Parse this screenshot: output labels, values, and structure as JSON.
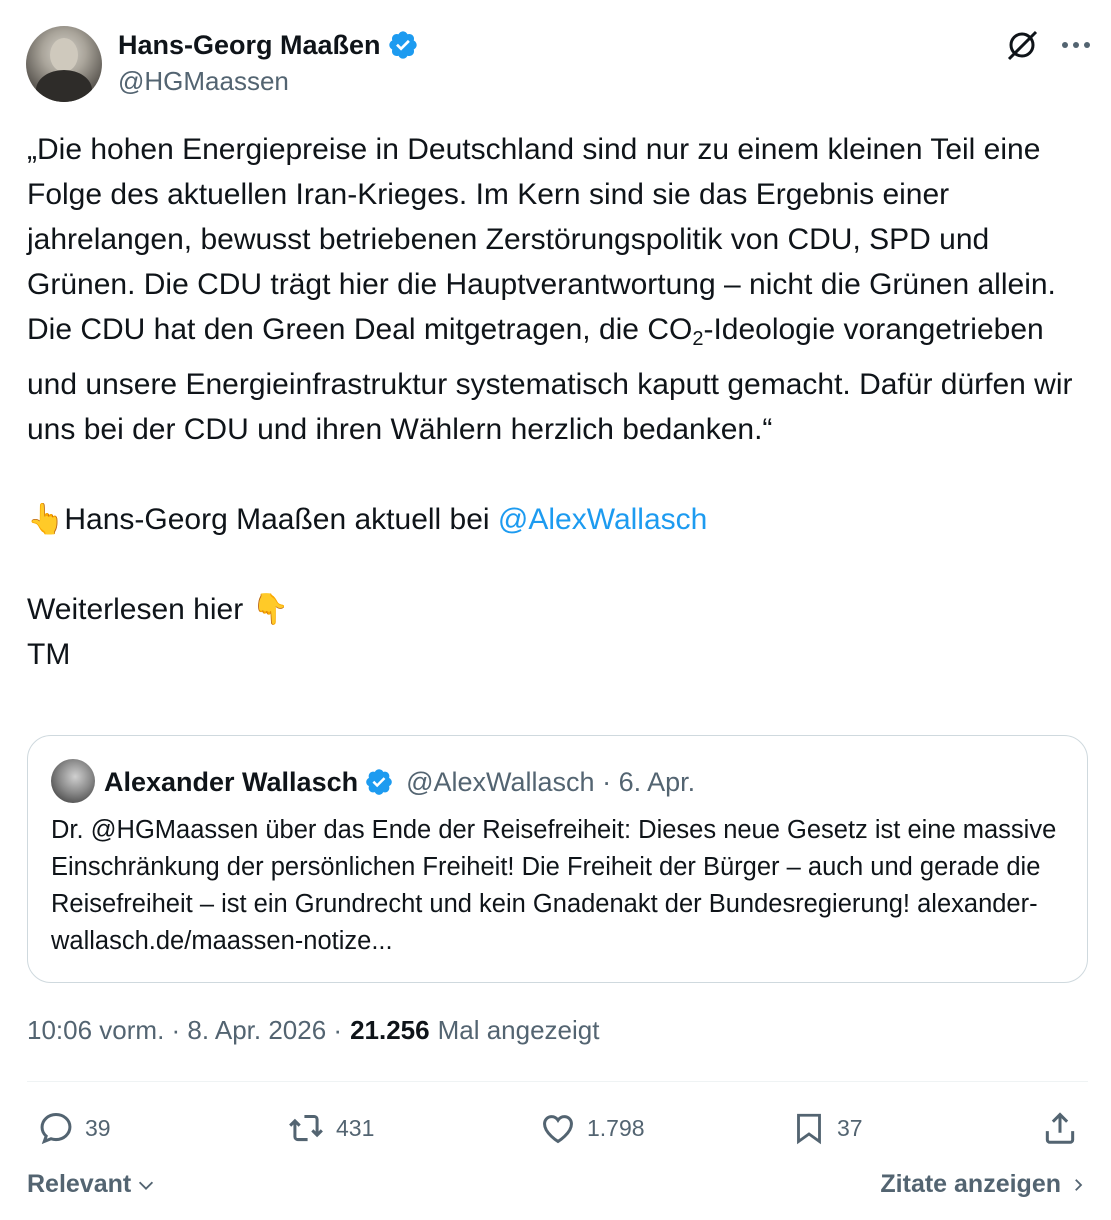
{
  "author": {
    "display_name": "Hans-Georg Maaßen",
    "handle": "@HGMaassen"
  },
  "tweet": {
    "p1_a": "„Die hohen Energiepreise in Deutschland sind nur zu einem kleinen Teil eine Folge des aktuellen Iran-Krieges. Im Kern sind sie das Ergebnis einer jahrelangen, bewusst betriebenen Zerstörungspolitik von CDU, SPD und Grünen. Die CDU trägt hier die Hauptverantwortung – nicht die Grünen allein. Die CDU hat den Green Deal mitgetragen, die CO",
    "p1_sub": "2",
    "p1_b": "-Ideologie vorangetrieben und unsere Energieinfrastruktur systematisch kaputt gemacht. Dafür dürfen wir uns bei der CDU und ihren Wählern herzlich bedanken.“",
    "p2_text": "Hans-Georg Maaßen aktuell bei ",
    "p2_mention": "@AlexWallasch",
    "p3_text": "Weiterlesen hier ",
    "p4_text": "TM",
    "emoji_up": "👆",
    "emoji_down": "👇"
  },
  "quote": {
    "display_name": "Alexander Wallasch",
    "handle_date": "@AlexWallasch · 6. Apr.",
    "text": "Dr. @HGMaassen über das Ende der Reisefreiheit: Dieses neue Gesetz ist eine massive Einschränkung der persönlichen Freiheit! Die Freiheit der Bürger – auch und gerade die Reisefreiheit – ist ein Grundrecht und kein Gnadenakt der Bundesregierung! alexander-wallasch.de/maassen-notize..."
  },
  "meta": {
    "time_date": "10:06 vorm. · 8. Apr. 2026 ·",
    "views": "21.256",
    "views_label": "Mal angezeigt"
  },
  "actions": {
    "replies": "39",
    "reposts": "431",
    "likes": "1.798",
    "bookmarks": "37"
  },
  "footer": {
    "sort_label": "Relevant",
    "quotes_label": "Zitate anzeigen"
  },
  "colors": {
    "link": "#1d9bf0",
    "secondary": "#536471",
    "verified": "#1d9bf0"
  }
}
